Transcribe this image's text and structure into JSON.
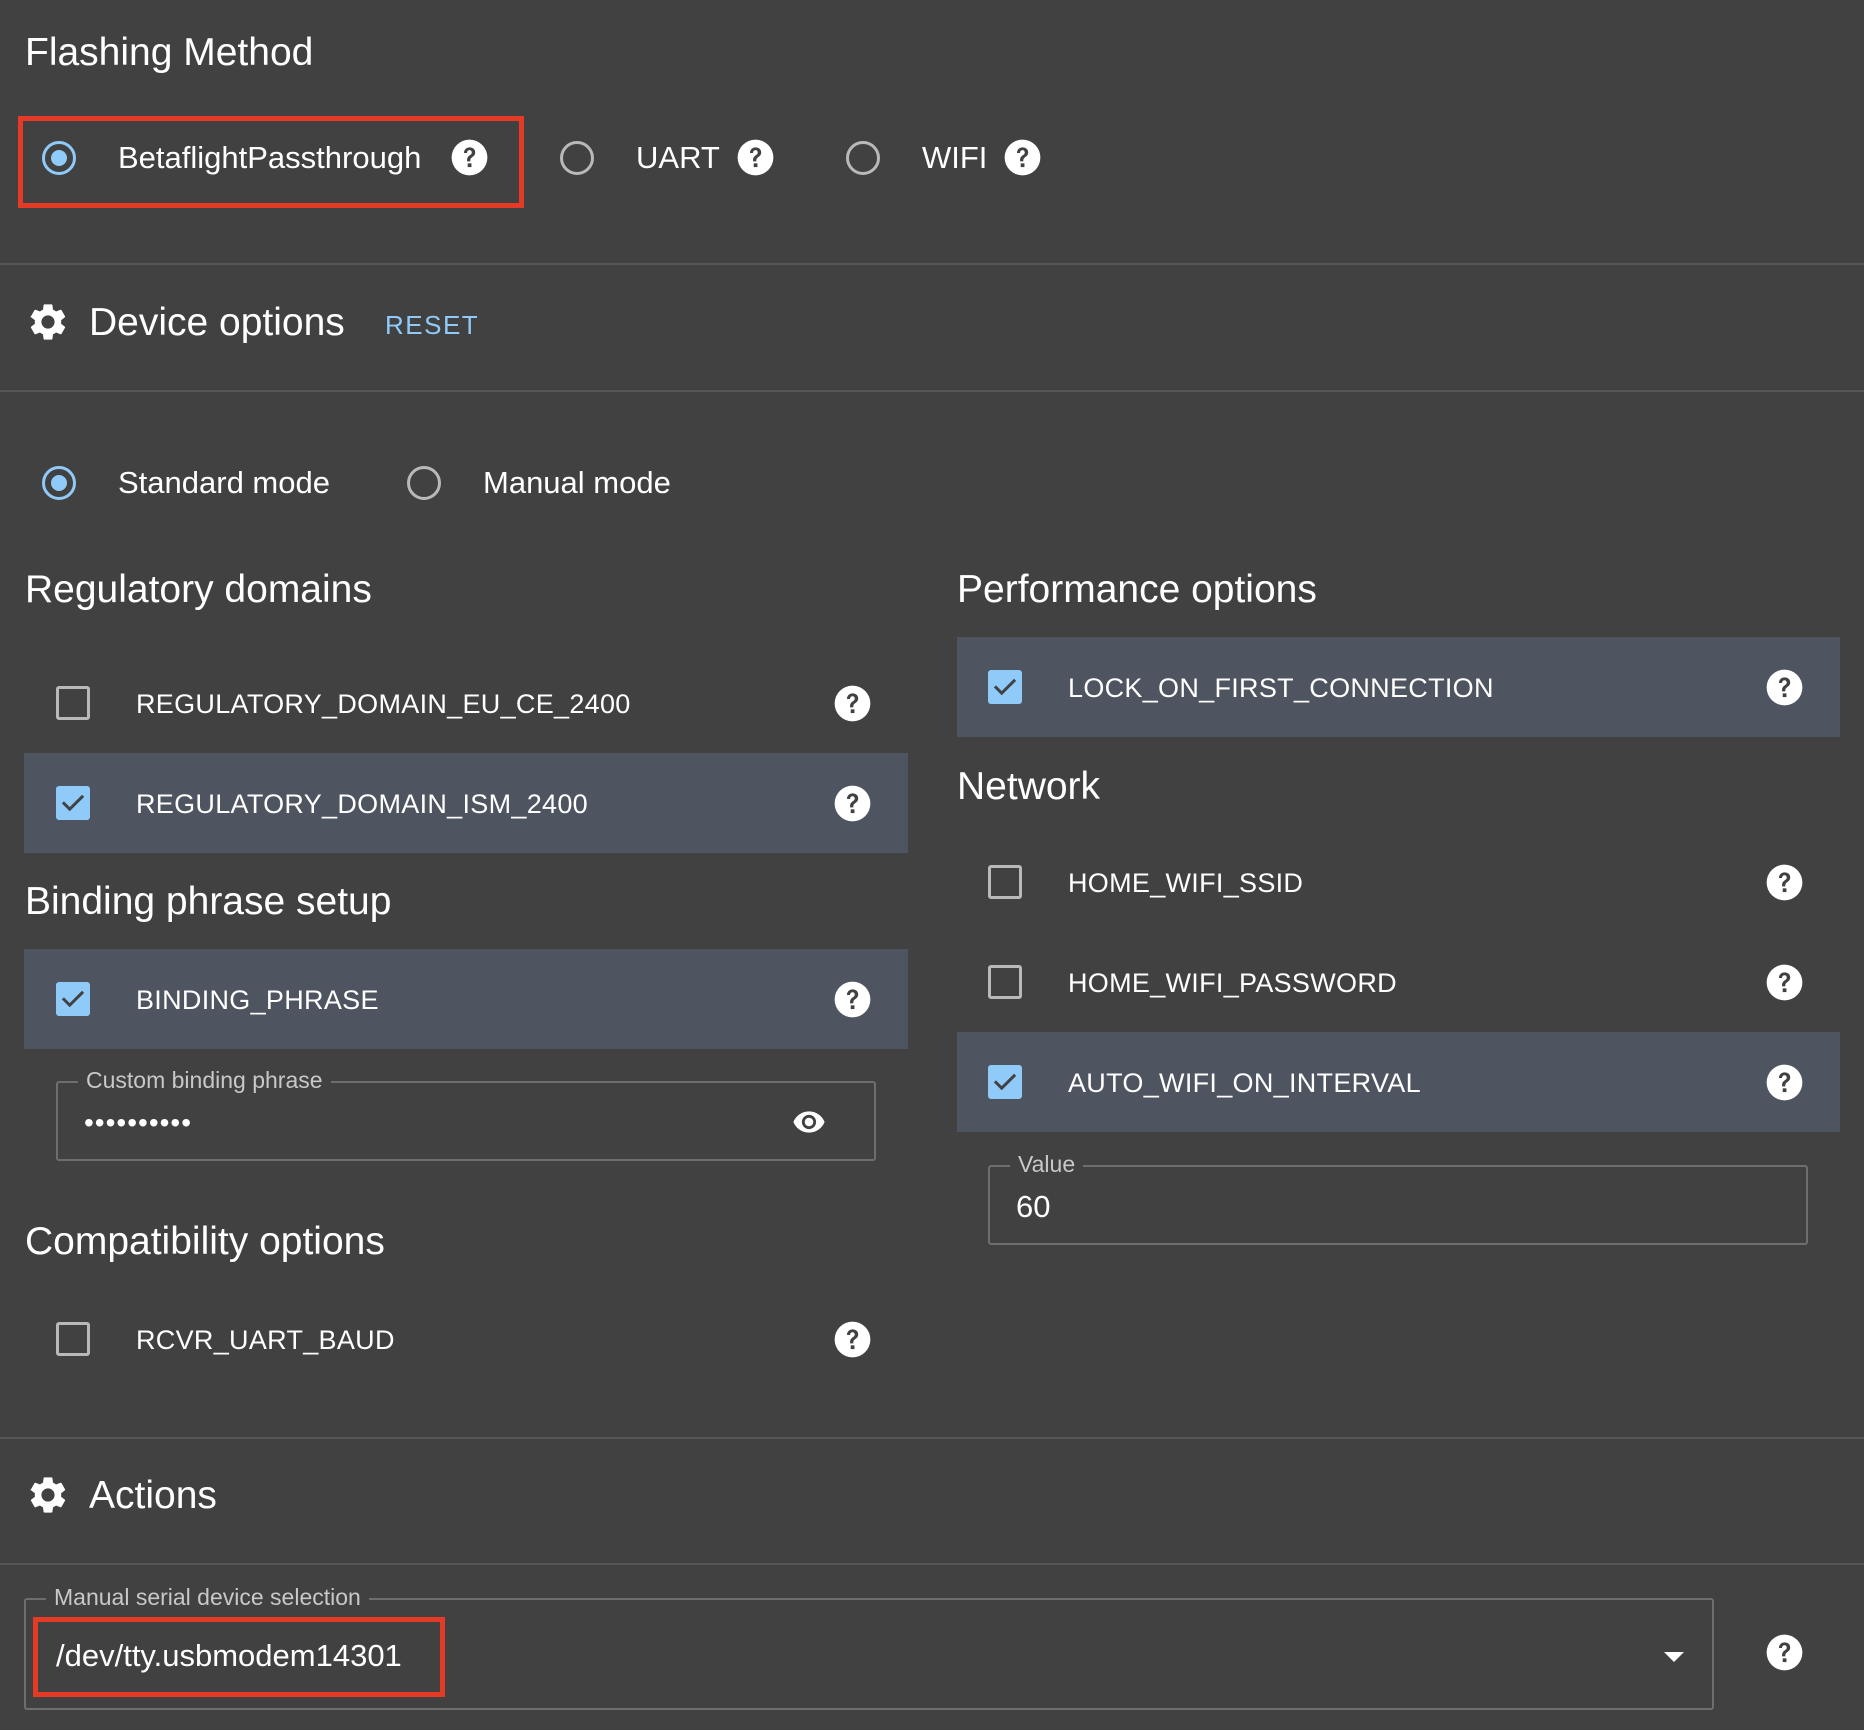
{
  "flashing": {
    "title": "Flashing Method",
    "options": [
      {
        "label": "BetaflightPassthrough",
        "selected": true
      },
      {
        "label": "UART",
        "selected": false
      },
      {
        "label": "WIFI",
        "selected": false
      }
    ]
  },
  "device_options": {
    "title": "Device options",
    "reset_label": "RESET",
    "modes": [
      {
        "label": "Standard mode",
        "selected": true
      },
      {
        "label": "Manual mode",
        "selected": false
      }
    ]
  },
  "regulatory": {
    "title": "Regulatory domains",
    "items": [
      {
        "label": "REGULATORY_DOMAIN_EU_CE_2400",
        "checked": false
      },
      {
        "label": "REGULATORY_DOMAIN_ISM_2400",
        "checked": true
      }
    ]
  },
  "binding": {
    "title": "Binding phrase setup",
    "item": {
      "label": "BINDING_PHRASE",
      "checked": true
    },
    "field_label": "Custom binding phrase",
    "field_value": "••••••••••"
  },
  "compatibility": {
    "title": "Compatibility options",
    "item": {
      "label": "RCVR_UART_BAUD",
      "checked": false
    }
  },
  "performance": {
    "title": "Performance options",
    "item": {
      "label": "LOCK_ON_FIRST_CONNECTION",
      "checked": true
    }
  },
  "network": {
    "title": "Network",
    "items": [
      {
        "label": "HOME_WIFI_SSID",
        "checked": false
      },
      {
        "label": "HOME_WIFI_PASSWORD",
        "checked": false
      },
      {
        "label": "AUTO_WIFI_ON_INTERVAL",
        "checked": true
      }
    ],
    "value_label": "Value",
    "value": "60"
  },
  "actions": {
    "title": "Actions",
    "serial_label": "Manual serial device selection",
    "serial_value": "/dev/tty.usbmodem14301"
  },
  "colors": {
    "background": "#414141",
    "accent": "#90caf9",
    "highlight_row": "#4e5560",
    "annotation_red": "#e53a25"
  }
}
